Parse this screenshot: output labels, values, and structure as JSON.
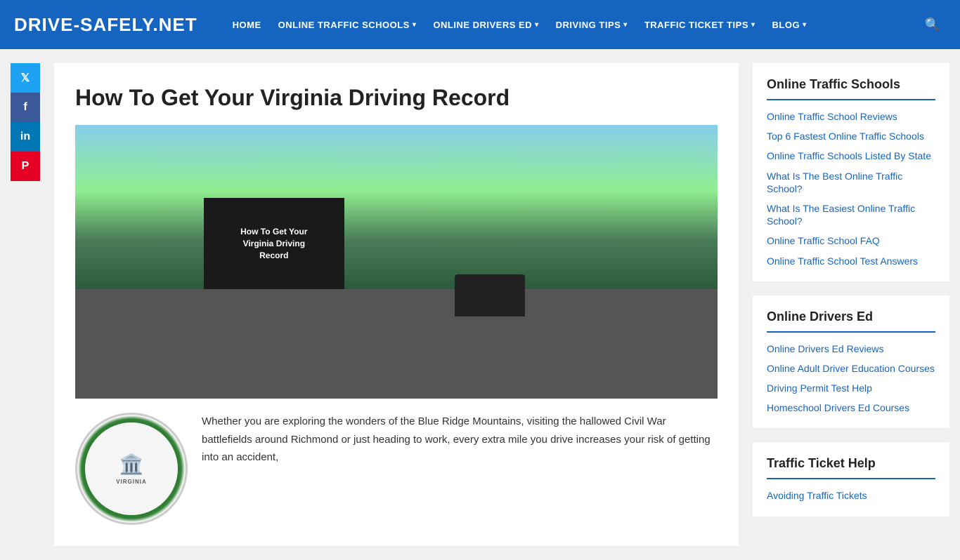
{
  "site": {
    "logo": "DRIVE-SAFELY.NET",
    "nav": [
      {
        "id": "home",
        "label": "HOME",
        "hasDropdown": false
      },
      {
        "id": "online-traffic-schools",
        "label": "ONLINE TRAFFIC SCHOOLS",
        "hasDropdown": true
      },
      {
        "id": "online-drivers-ed",
        "label": "ONLINE DRIVERS ED",
        "hasDropdown": true
      },
      {
        "id": "driving-tips",
        "label": "DRIVING TIPS",
        "hasDropdown": true
      },
      {
        "id": "traffic-ticket-tips",
        "label": "TRAFFIC TICKET TIPS",
        "hasDropdown": true
      },
      {
        "id": "blog",
        "label": "BLOG",
        "hasDropdown": true
      }
    ]
  },
  "social": [
    {
      "id": "twitter",
      "icon": "𝕏",
      "label": "Twitter",
      "class": "twitter"
    },
    {
      "id": "facebook",
      "icon": "f",
      "label": "Facebook",
      "class": "facebook"
    },
    {
      "id": "linkedin",
      "icon": "in",
      "label": "LinkedIn",
      "class": "linkedin"
    },
    {
      "id": "pinterest",
      "icon": "P",
      "label": "Pinterest",
      "class": "pinterest"
    }
  ],
  "article": {
    "title": "How To Get Your Virginia Driving Record",
    "hero_text_line1": "How To Get Your",
    "hero_text_line2": "Virginia Driving",
    "hero_text_line3": "Record",
    "intro_text": "Whether you are exploring the wonders of the Blue Ridge Mountains, visiting the hallowed Civil War battlefields around Richmond or just heading to work, every extra mile you drive increases your risk of getting into an accident,"
  },
  "sidebar": {
    "widgets": [
      {
        "id": "online-traffic-schools",
        "title": "Online Traffic Schools",
        "links": [
          {
            "id": "reviews",
            "label": "Online Traffic School Reviews"
          },
          {
            "id": "fastest",
            "label": "Top 6 Fastest Online Traffic Schools"
          },
          {
            "id": "by-state",
            "label": "Online Traffic Schools Listed By State"
          },
          {
            "id": "best",
            "label": "What Is The Best Online Traffic School?"
          },
          {
            "id": "easiest",
            "label": "What Is The Easiest Online Traffic School?"
          },
          {
            "id": "faq",
            "label": "Online Traffic School FAQ"
          },
          {
            "id": "test-answers",
            "label": "Online Traffic School Test Answers"
          }
        ]
      },
      {
        "id": "online-drivers-ed",
        "title": "Online Drivers Ed",
        "links": [
          {
            "id": "drivers-ed-reviews",
            "label": "Online Drivers Ed Reviews"
          },
          {
            "id": "adult-driver-ed",
            "label": "Online Adult Driver Education Courses"
          },
          {
            "id": "permit-test",
            "label": "Driving Permit Test Help"
          },
          {
            "id": "homeschool",
            "label": "Homeschool Drivers Ed Courses"
          }
        ]
      },
      {
        "id": "traffic-ticket-help",
        "title": "Traffic Ticket Help",
        "links": [
          {
            "id": "avoiding-tickets",
            "label": "Avoiding Traffic Tickets"
          }
        ]
      }
    ]
  },
  "seal": {
    "label": "VIRGINIA",
    "figure": "🏛️"
  }
}
